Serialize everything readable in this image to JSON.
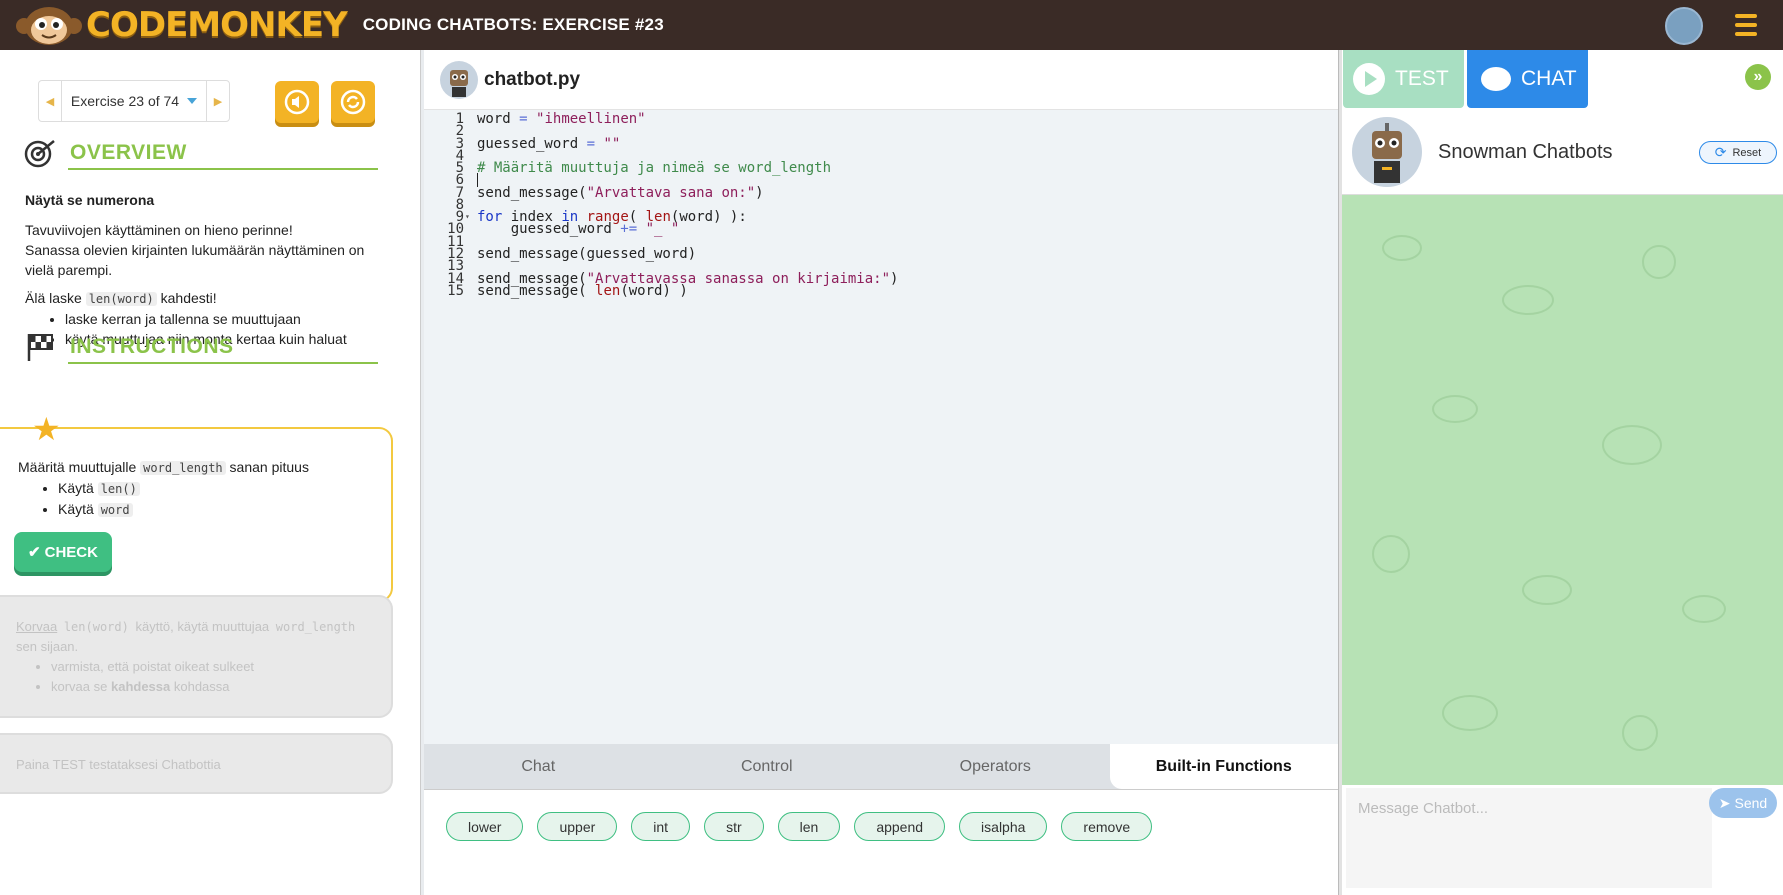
{
  "header": {
    "logo_text": "CODEMONKEY",
    "title": "CODING CHATBOTS: EXERCISE #23",
    "accent": "#f3b325",
    "bg": "#3a2b26"
  },
  "left": {
    "exercise_selector": "Exercise 23 of 74",
    "overview_heading": "OVERVIEW",
    "overview_title": "Näytä se numerona",
    "overview_p1_line1": "Tavuviivojen käyttäminen on hieno perinne!",
    "overview_p1_line2": "Sanassa olevien kirjainten lukumäärän näyttäminen on vielä parempi.",
    "overview_p2_pre": "Älä laske ",
    "overview_p2_code": "len(word)",
    "overview_p2_post": " kahdesti!",
    "overview_bullets": [
      "laske kerran ja tallenna se muuttujaan",
      "käytä muuttujaa niin monta kertaa kuin haluat"
    ],
    "instructions_heading": "INSTRUCTIONS",
    "task_pre": "Määritä muuttujalle ",
    "task_code": "word_length",
    "task_post": " sanan pituus",
    "task_b1_pre": "Käytä ",
    "task_b1_code": "len()",
    "task_b2_pre": "Käytä ",
    "task_b2_code": "word",
    "check_label": "CHECK",
    "next_task_link": "Korvaa",
    "next_task_code1": "len(word)",
    "next_task_mid": " käyttö, käytä muuttujaa ",
    "next_task_code2": "word_length",
    "next_task_post": " sen sijaan.",
    "next_task_b1": "varmista, että poistat oikeat sulkeet",
    "next_task_b2_pre": "korvaa se ",
    "next_task_b2_bold": "kahdessa",
    "next_task_b2_post": " kohdassa",
    "test_hint": "Paina TEST testataksesi Chatbottia"
  },
  "editor": {
    "filename": "chatbot.py",
    "line_numbers": [
      "1",
      "2",
      "3",
      "4",
      "5",
      "6",
      "7",
      "8",
      "9",
      "10",
      "11",
      "12",
      "13",
      "14",
      "15"
    ],
    "tabs": [
      "Chat",
      "Control",
      "Operators",
      "Built-in Functions"
    ],
    "active_tab": "Built-in Functions",
    "chips": [
      "lower",
      "upper",
      "int",
      "str",
      "len",
      "append",
      "isalpha",
      "remove"
    ]
  },
  "right": {
    "test_label": "TEST",
    "chat_label": "CHAT",
    "bot_name": "Snowman Chatbots",
    "reset_label": "Reset",
    "message_placeholder": "Message Chatbot...",
    "send_label": "Send",
    "chat_bg": "#b7e2b5"
  }
}
